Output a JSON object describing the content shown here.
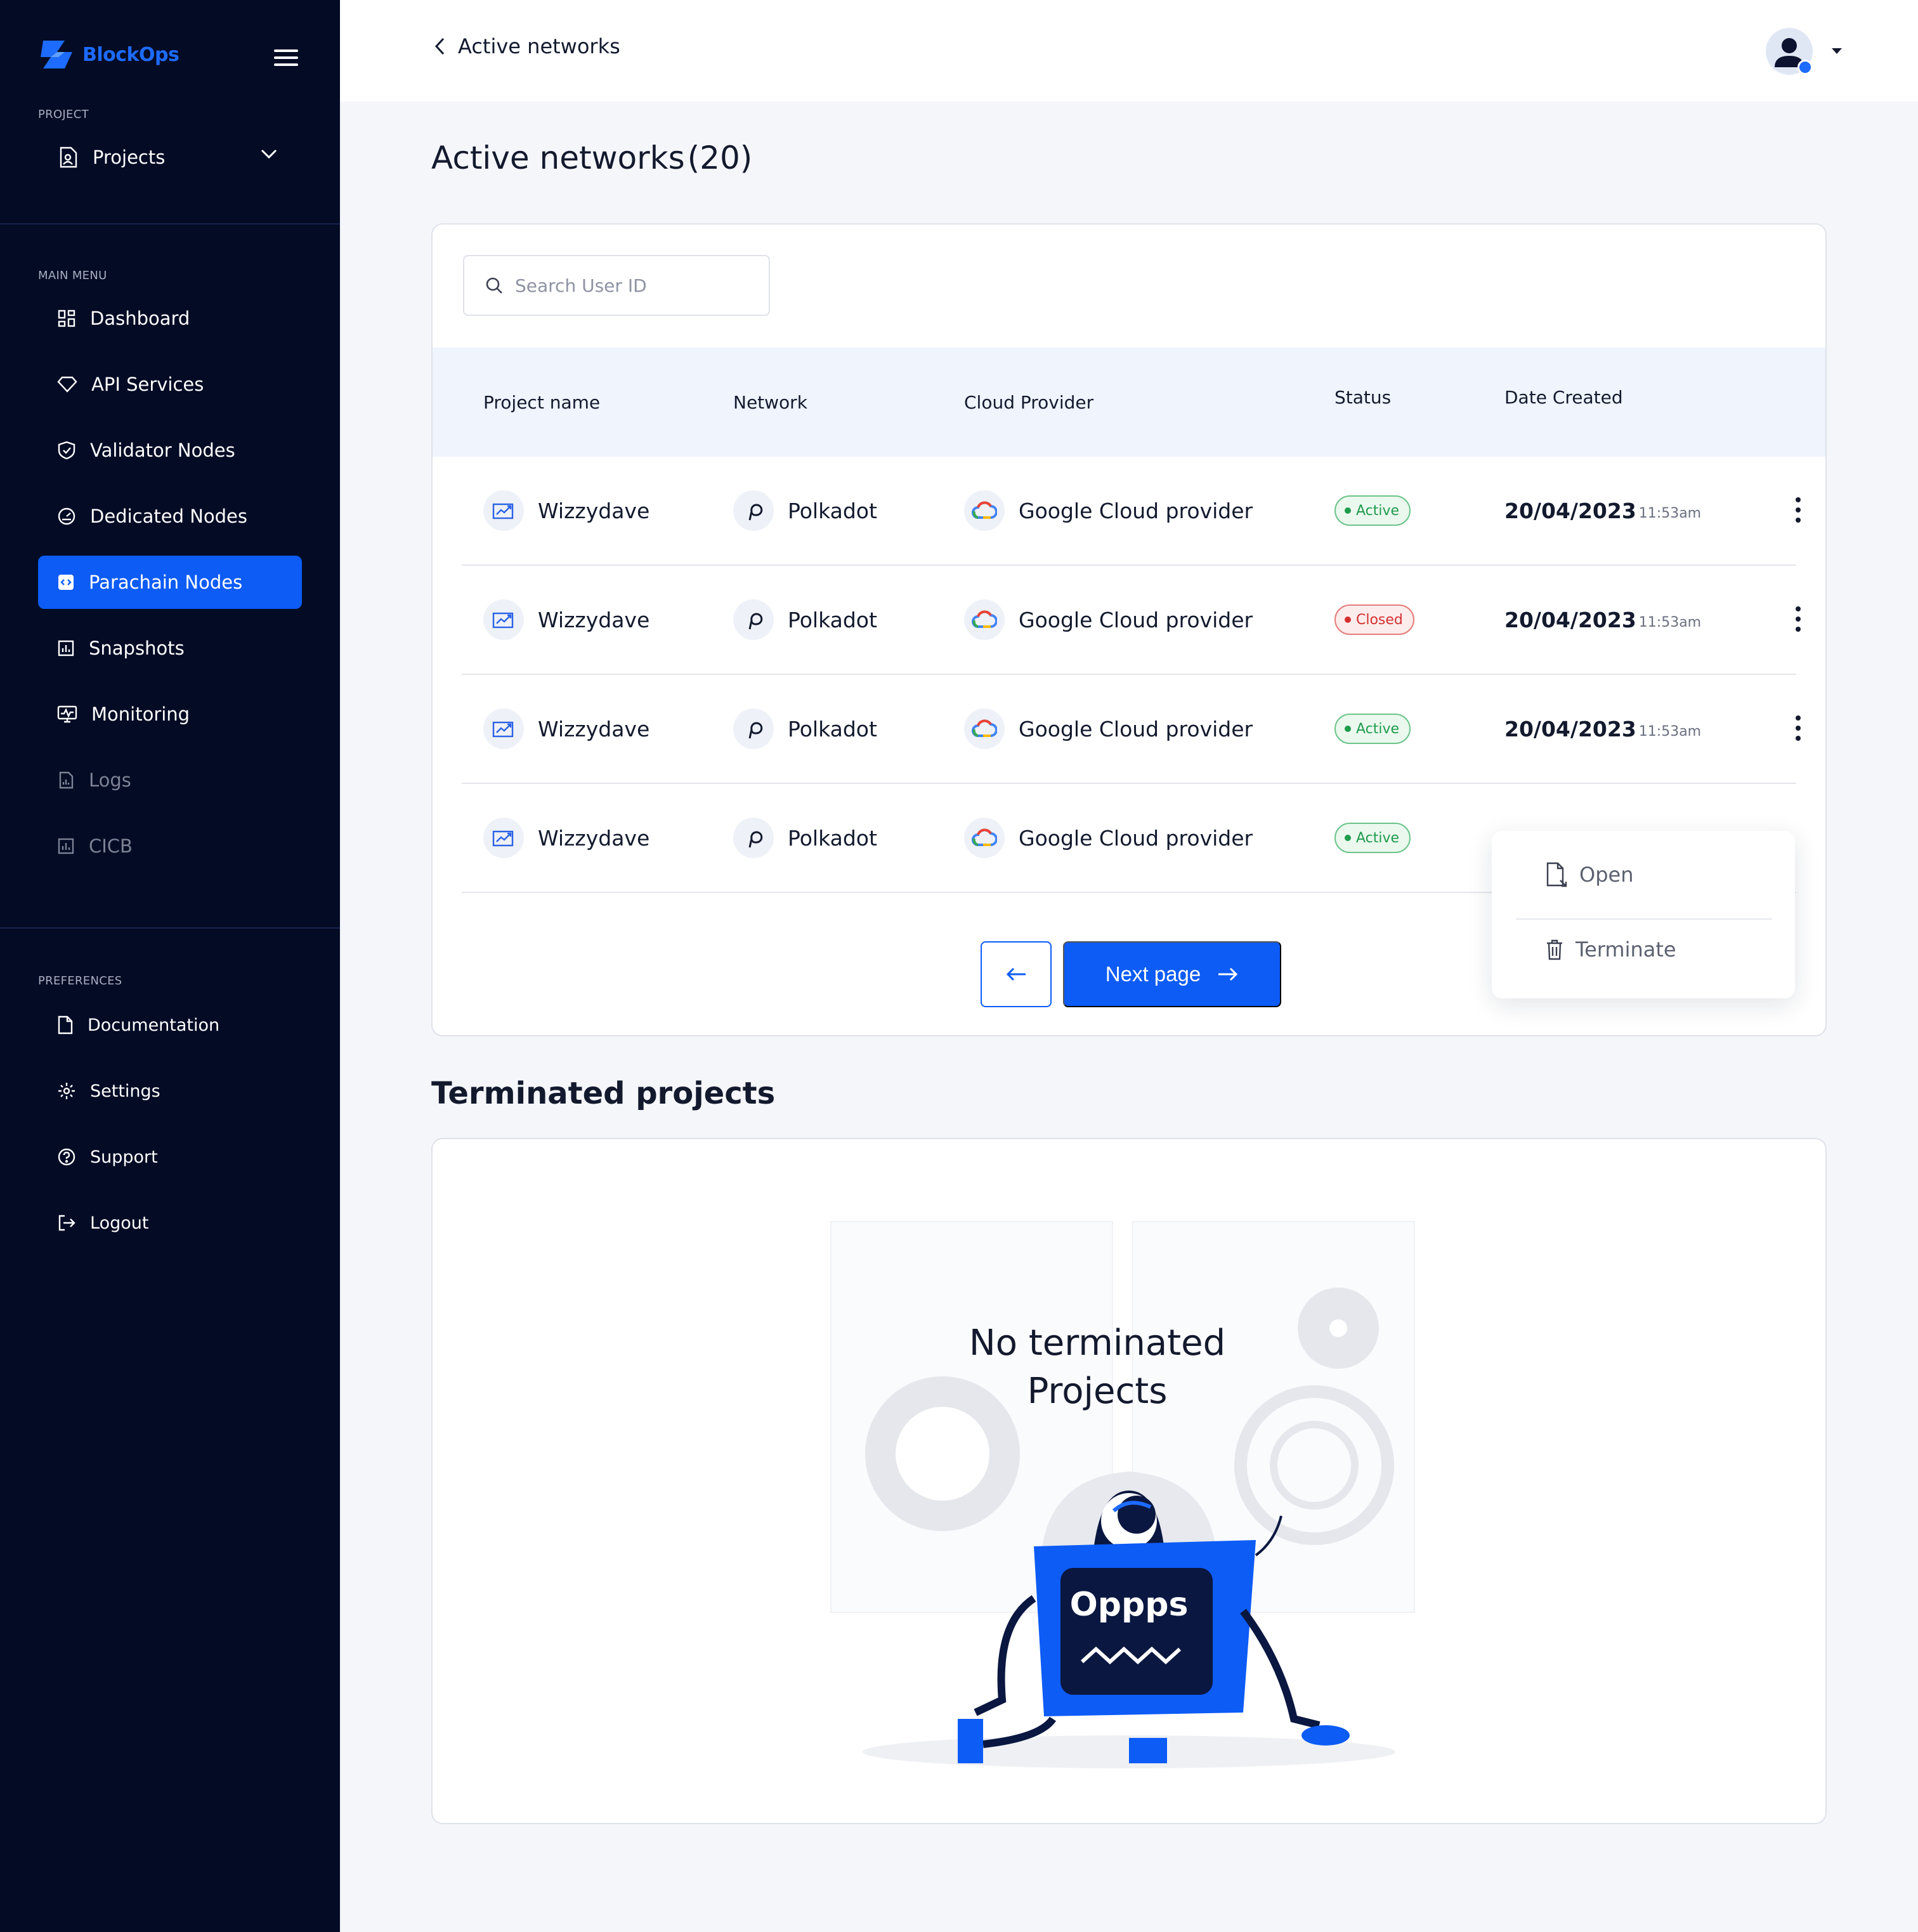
{
  "brand": {
    "name": "BlockOps"
  },
  "sidebar": {
    "sections": {
      "project": "PROJECT",
      "main_menu": "MAIN MENU",
      "preferences": "PREFERENCES"
    },
    "project_selector": {
      "label": "Projects"
    },
    "main_items": [
      {
        "label": "Dashboard",
        "icon": "grid-icon"
      },
      {
        "label": "API Services",
        "icon": "diamond-icon"
      },
      {
        "label": "Validator Nodes",
        "icon": "shield-icon"
      },
      {
        "label": "Dedicated Nodes",
        "icon": "gauge-icon"
      },
      {
        "label": "Parachain Nodes",
        "icon": "code-box-icon",
        "active": true
      },
      {
        "label": "Snapshots",
        "icon": "chart-box-icon"
      },
      {
        "label": "Monitoring",
        "icon": "monitor-icon"
      },
      {
        "label": "Logs",
        "icon": "doc-chart-icon",
        "disabled": true
      },
      {
        "label": "CICB",
        "icon": "chart-box-icon",
        "disabled": true
      }
    ],
    "preference_items": [
      {
        "label": "Documentation",
        "icon": "document-icon"
      },
      {
        "label": "Settings",
        "icon": "gear-icon"
      },
      {
        "label": "Support",
        "icon": "help-icon"
      },
      {
        "label": "Logout",
        "icon": "logout-icon"
      }
    ]
  },
  "topbar": {
    "back_label": "Active networks"
  },
  "active_networks": {
    "title": "Active networks",
    "count": "(20)",
    "search_placeholder": "Search User ID",
    "columns": [
      "Project name",
      "Network",
      "Cloud Provider",
      "Status",
      "Date Created"
    ],
    "rows": [
      {
        "project": "Wizzydave",
        "network": "Polkadot",
        "provider": "Google Cloud provider",
        "status": "Active",
        "date": "20/04/2023",
        "time": "11:53am"
      },
      {
        "project": "Wizzydave",
        "network": "Polkadot",
        "provider": "Google Cloud provider",
        "status": "Closed",
        "date": "20/04/2023",
        "time": "11:53am"
      },
      {
        "project": "Wizzydave",
        "network": "Polkadot",
        "provider": "Google Cloud provider",
        "status": "Active",
        "date": "20/04/2023",
        "time": "11:53am"
      },
      {
        "project": "Wizzydave",
        "network": "Polkadot",
        "provider": "Google Cloud provider",
        "status": "Active",
        "date": "",
        "time": ""
      }
    ],
    "row_menu": {
      "open": "Open",
      "terminate": "Terminate"
    },
    "pagination": {
      "next_label": "Next page"
    }
  },
  "terminated": {
    "title": "Terminated projects",
    "empty_line1": "No terminated",
    "empty_line2": "Projects",
    "illustration_text": "Oppps"
  },
  "colors": {
    "sidebar_bg": "#030b25",
    "accent": "#0d5cf6",
    "active_green": "#1f9b4c",
    "closed_red": "#d42f2f"
  }
}
